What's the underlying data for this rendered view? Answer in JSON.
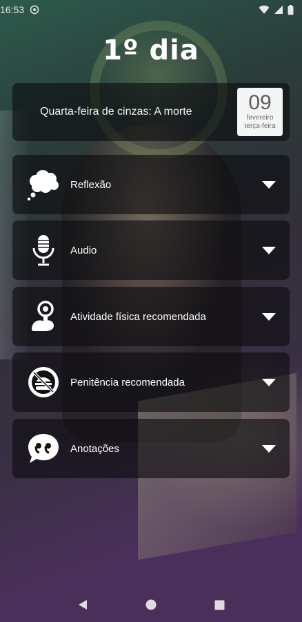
{
  "status_bar": {
    "time": "16:53",
    "icons": [
      "sync-icon",
      "wifi-icon",
      "signal-icon",
      "battery-icon"
    ]
  },
  "page": {
    "title": "1º dia"
  },
  "day_card": {
    "title": "Quarta-feira de cinzas: A morte",
    "date": {
      "day": "09",
      "month": "fevereiro",
      "weekday": "terça-feira"
    }
  },
  "sections": [
    {
      "label": "Reflexão",
      "icon": "thought-bubble-icon"
    },
    {
      "label": "Audio",
      "icon": "microphone-icon"
    },
    {
      "label": "Atividade física recomendada",
      "icon": "person-activity-icon"
    },
    {
      "label": "Penitência recomendada",
      "icon": "no-food-icon"
    },
    {
      "label": "Anotações",
      "icon": "quote-icon"
    }
  ],
  "nav_bar": {
    "icons": [
      "back-icon",
      "home-icon",
      "recents-icon"
    ]
  },
  "colors": {
    "card_bg": "#0c0c0e",
    "text": "#ffffff",
    "badge_bg": "#f4f6f6"
  }
}
